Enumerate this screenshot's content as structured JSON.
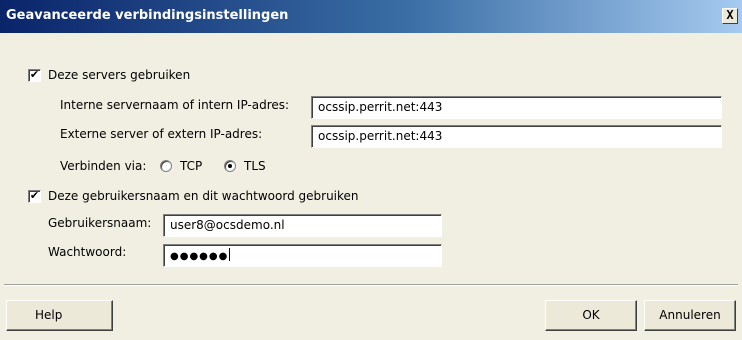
{
  "dialog": {
    "title": "Geavanceerde verbindingsinstellingen",
    "close_glyph": "X"
  },
  "servers": {
    "checkbox_label": "Deze servers gebruiken",
    "checked": true,
    "internal_label": "Interne servernaam of intern IP-adres:",
    "internal_value": "ocssip.perrit.net:443",
    "external_label": "Externe server of extern IP-adres:",
    "external_value": "ocssip.perrit.net:443",
    "connect_label": "Verbinden via:",
    "tcp_label": "TCP",
    "tls_label": "TLS",
    "selected_protocol": "TLS"
  },
  "credentials": {
    "checkbox_label": "Deze gebruikersnaam en dit wachtwoord gebruiken",
    "checked": true,
    "username_label": "Gebruikersnaam:",
    "username_value": "user8@ocsdemo.nl",
    "password_label": "Wachtwoord:",
    "password_value": "●●●●●●"
  },
  "buttons": {
    "help": "Help",
    "ok": "OK",
    "cancel": "Annuleren"
  },
  "icons": {
    "checkbox_check": "✔",
    "close": "close-icon"
  }
}
